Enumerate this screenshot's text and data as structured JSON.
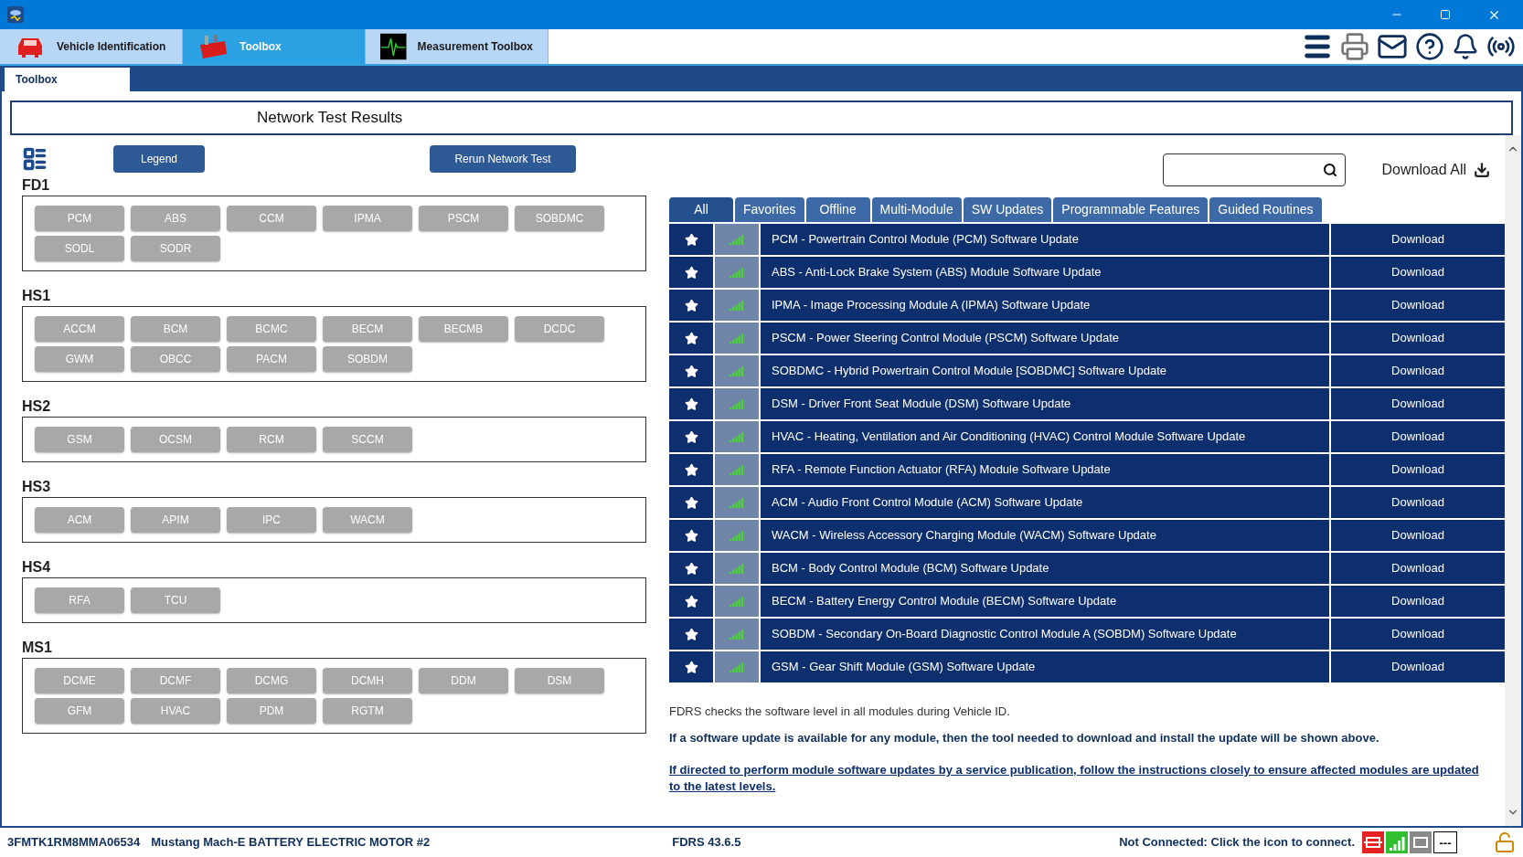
{
  "app_tabs": [
    {
      "label": "Vehicle Identification",
      "kind": "car",
      "selected": false
    },
    {
      "label": "Toolbox",
      "kind": "toolbox",
      "selected": true
    },
    {
      "label": "Measurement Toolbox",
      "kind": "scope",
      "selected": false
    }
  ],
  "sub_tabs": [
    {
      "label": "Toolbox",
      "selected": true
    }
  ],
  "header": "Network Test Results",
  "left": {
    "legend_button": "Legend",
    "rerun_button": "Rerun Network Test",
    "networks": [
      {
        "name": "FD1",
        "modules": [
          "PCM",
          "ABS",
          "CCM",
          "IPMA",
          "PSCM",
          "SOBDMC",
          "SODL",
          "SODR"
        ]
      },
      {
        "name": "HS1",
        "modules": [
          "ACCM",
          "BCM",
          "BCMC",
          "BECM",
          "BECMB",
          "DCDC",
          "GWM",
          "OBCC",
          "PACM",
          "SOBDM"
        ]
      },
      {
        "name": "HS2",
        "modules": [
          "GSM",
          "OCSM",
          "RCM",
          "SCCM"
        ]
      },
      {
        "name": "HS3",
        "modules": [
          "ACM",
          "APIM",
          "IPC",
          "WACM"
        ]
      },
      {
        "name": "HS4",
        "modules": [
          "RFA",
          "TCU"
        ]
      },
      {
        "name": "MS1",
        "modules": [
          "DCME",
          "DCMF",
          "DCMG",
          "DCMH",
          "DDM",
          "DSM",
          "GFM",
          "HVAC",
          "PDM",
          "RGTM"
        ]
      }
    ]
  },
  "right": {
    "download_all": "Download All",
    "filter_tabs": [
      {
        "label": "All",
        "selected": true
      },
      {
        "label": "Favorites",
        "selected": false
      },
      {
        "label": "Offline",
        "selected": false
      },
      {
        "label": "Multi-Module",
        "selected": false
      },
      {
        "label": "SW Updates",
        "selected": false
      },
      {
        "label": "Programmable Features",
        "selected": false
      },
      {
        "label": "Guided Routines",
        "selected": false
      }
    ],
    "rows": [
      {
        "title": "PCM - Powertrain Control Module (PCM) Software Update",
        "action": "Download"
      },
      {
        "title": "ABS - Anti-Lock Brake System (ABS) Module Software Update",
        "action": "Download"
      },
      {
        "title": "IPMA - Image Processing Module A (IPMA) Software Update",
        "action": "Download"
      },
      {
        "title": "PSCM - Power Steering Control Module (PSCM) Software Update",
        "action": "Download"
      },
      {
        "title": "SOBDMC - Hybrid Powertrain Control Module [SOBDMC] Software Update",
        "action": "Download"
      },
      {
        "title": "DSM - Driver Front Seat Module (DSM) Software Update",
        "action": "Download"
      },
      {
        "title": "HVAC - Heating, Ventilation and Air Conditioning (HVAC) Control Module Software Update",
        "action": "Download"
      },
      {
        "title": "RFA - Remote Function Actuator (RFA) Module Software Update",
        "action": "Download"
      },
      {
        "title": "ACM - Audio Front Control Module (ACM) Software Update",
        "action": "Download"
      },
      {
        "title": "WACM - Wireless Accessory Charging Module (WACM) Software Update",
        "action": "Download"
      },
      {
        "title": "BCM - Body Control Module (BCM) Software Update",
        "action": "Download"
      },
      {
        "title": "BECM - Battery Energy Control Module (BECM) Software Update",
        "action": "Download"
      },
      {
        "title": "SOBDM - Secondary On-Board Diagnostic Control Module A (SOBDM) Software Update",
        "action": "Download"
      },
      {
        "title": "GSM - Gear Shift Module (GSM) Software Update",
        "action": "Download"
      }
    ],
    "note": "FDRS checks the software level in all modules during Vehicle ID.",
    "note_bold": "If a software update is available for any module, then the tool needed to download and install the update will be shown above.",
    "link": "If directed to perform module software updates by a service publication, follow the instructions closely to ensure affected modules are updated to the latest levels."
  },
  "status_bar": {
    "vin": "3FMTK1RM8MMA06534",
    "vehicle": "Mustang Mach-E BATTERY ELECTRIC MOTOR #2",
    "version": "FDRS 43.6.5",
    "connection": "Not Connected: Click the icon to connect.",
    "indicator": "---"
  }
}
